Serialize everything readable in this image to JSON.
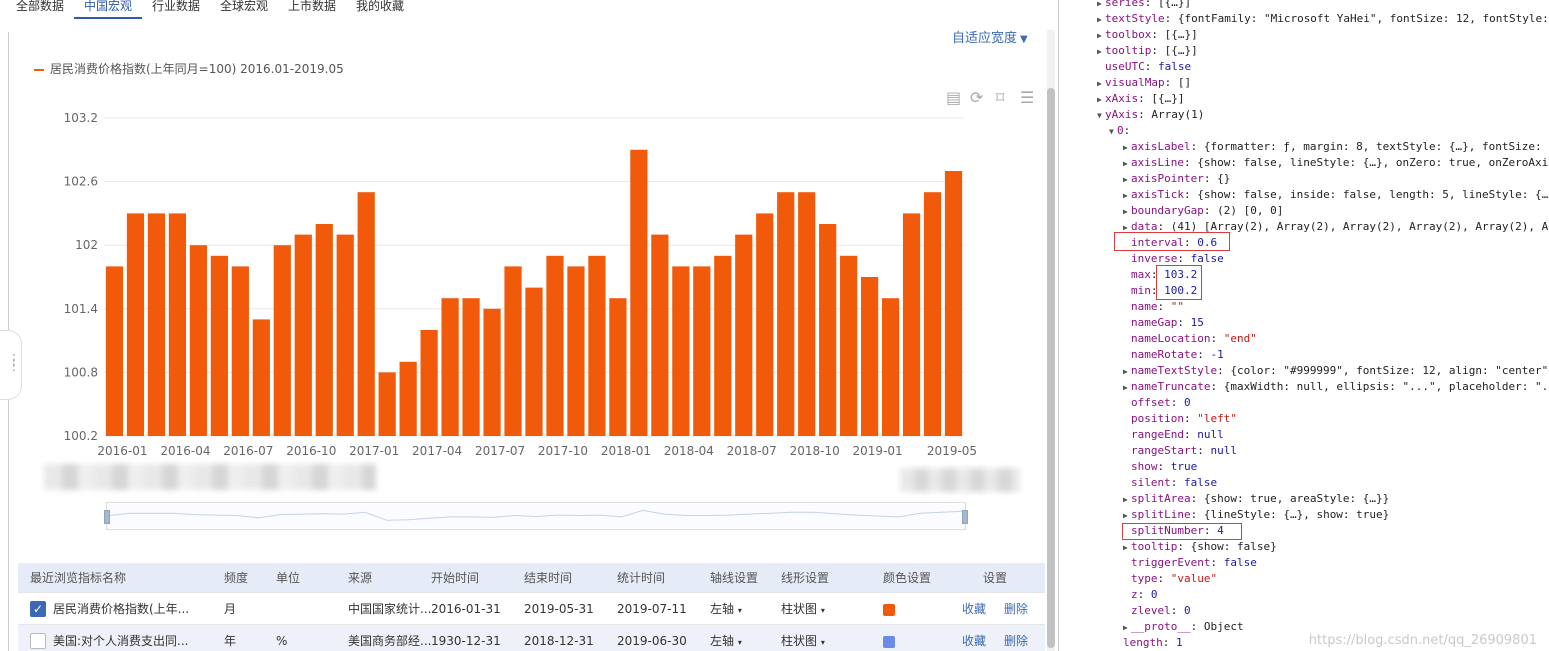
{
  "tabs": [
    "全部数据",
    "中国宏观",
    "行业数据",
    "全球宏观",
    "上市数据",
    "我的收藏"
  ],
  "active_tab": "中国宏观",
  "adapt_label": "自适应宽度",
  "legend_label": "居民消费价格指数(上年同月=100) 2016.01-2019.05",
  "colors": {
    "bar": "#f05a0a",
    "accent": "#3b6bb5",
    "swatch2": "#6b8be8"
  },
  "toolbox_icons": [
    "data-view-icon",
    "refresh-icon",
    "bookmark-icon",
    "menu-icon"
  ],
  "chart_data": {
    "type": "bar",
    "title": "",
    "series": [
      {
        "name": "居民消费价格指数(上年同月=100) 2016.01-2019.05",
        "values": [
          101.8,
          102.3,
          102.3,
          102.3,
          102.0,
          101.9,
          101.8,
          101.3,
          102.0,
          102.1,
          102.2,
          102.1,
          102.5,
          100.8,
          100.9,
          101.2,
          101.5,
          101.5,
          101.4,
          101.8,
          101.6,
          101.9,
          101.8,
          101.9,
          101.5,
          102.9,
          102.1,
          101.8,
          101.8,
          101.9,
          102.1,
          102.3,
          102.5,
          102.5,
          102.2,
          101.9,
          101.7,
          101.5,
          102.3,
          102.5,
          102.7
        ]
      }
    ],
    "categories": [
      "2016-01",
      "2016-02",
      "2016-03",
      "2016-04",
      "2016-05",
      "2016-06",
      "2016-07",
      "2016-08",
      "2016-09",
      "2016-10",
      "2016-11",
      "2016-12",
      "2017-01",
      "2017-02",
      "2017-03",
      "2017-04",
      "2017-05",
      "2017-06",
      "2017-07",
      "2017-08",
      "2017-09",
      "2017-10",
      "2017-11",
      "2017-12",
      "2018-01",
      "2018-02",
      "2018-03",
      "2018-04",
      "2018-05",
      "2018-06",
      "2018-07",
      "2018-08",
      "2018-09",
      "2018-10",
      "2018-11",
      "2018-12",
      "2019-01",
      "2019-02",
      "2019-03",
      "2019-04",
      "2019-05"
    ],
    "xtick_labels": [
      "2016-01",
      "2016-04",
      "2016-07",
      "2016-10",
      "2017-01",
      "2017-04",
      "2017-07",
      "2017-10",
      "2018-01",
      "2018-04",
      "2018-07",
      "2018-10",
      "2019-01",
      "2019-05"
    ],
    "ytick_labels": [
      "103.2",
      "102.6",
      "102",
      "101.4",
      "100.8",
      "100.2"
    ],
    "ylim": [
      100.2,
      103.2
    ],
    "ytick_values": [
      103.2,
      102.6,
      102.0,
      101.4,
      100.8,
      100.2
    ],
    "grid": true,
    "legend_position": "top-left"
  },
  "table": {
    "headers": [
      "最近浏览指标名称",
      "频度",
      "单位",
      "来源",
      "开始时间",
      "结束时间",
      "统计时间",
      "轴线设置",
      "线形设置",
      "颜色设置",
      "设置"
    ],
    "rows": [
      {
        "checked": true,
        "name": "居民消费价格指数(上年...",
        "freq": "月",
        "unit": "",
        "source": "中国国家统计...",
        "start": "2016-01-31",
        "end": "2019-05-31",
        "stat": "2019-07-11",
        "axis": "左轴",
        "shape": "柱状图",
        "color": "#f05a0a",
        "collect": "收藏",
        "delete": "删除"
      },
      {
        "checked": false,
        "name": "美国:对个人消费支出同...",
        "freq": "年",
        "unit": "%",
        "source": "美国商务部经...",
        "start": "1930-12-31",
        "end": "2018-12-31",
        "stat": "2019-06-30",
        "axis": "左轴",
        "shape": "柱状图",
        "color": "#6b8be8",
        "collect": "收藏",
        "delete": "删除"
      }
    ]
  },
  "devtools": [
    {
      "t": "▶",
      "k": "series",
      "v": "[{…}]"
    },
    {
      "t": "▶",
      "k": "textStyle",
      "v": "{fontFamily: \"Microsoft YaHei\", fontSize: 12, fontStyle:"
    },
    {
      "t": "▶",
      "k": "toolbox",
      "v": "[{…}]"
    },
    {
      "t": "▶",
      "k": "tooltip",
      "v": "[{…}]"
    },
    {
      "t": "",
      "k": "useUTC",
      "v": "false"
    },
    {
      "t": "▶",
      "k": "visualMap",
      "v": "[]"
    },
    {
      "t": "▶",
      "k": "xAxis",
      "v": "[{…}]"
    },
    {
      "t": "▼",
      "k": "yAxis",
      "v": "Array(1)"
    },
    {
      "t": "▼",
      "k": "0",
      "v": ""
    },
    {
      "t": "▶",
      "k": "axisLabel",
      "v": "{formatter: ƒ, margin: 8, textStyle: {…}, fontSize: 1"
    },
    {
      "t": "▶",
      "k": "axisLine",
      "v": "{show: false, lineStyle: {…}, onZero: true, onZeroAxis"
    },
    {
      "t": "▶",
      "k": "axisPointer",
      "v": "{}"
    },
    {
      "t": "▶",
      "k": "axisTick",
      "v": "{show: false, inside: false, length: 5, lineStyle: {…}"
    },
    {
      "t": "▶",
      "k": "boundaryGap",
      "v": "(2) [0, 0]"
    },
    {
      "t": "▶",
      "k": "data",
      "v": "(41) [Array(2), Array(2), Array(2), Array(2), Array(2), Ar"
    },
    {
      "t": "",
      "k": "interval",
      "v": "0.6"
    },
    {
      "t": "",
      "k": "inverse",
      "v": "false"
    },
    {
      "t": "",
      "k": "max",
      "v": "103.2"
    },
    {
      "t": "",
      "k": "min",
      "v": "100.2"
    },
    {
      "t": "",
      "k": "name",
      "v": "\"\""
    },
    {
      "t": "",
      "k": "nameGap",
      "v": "15"
    },
    {
      "t": "",
      "k": "nameLocation",
      "v": "\"end\""
    },
    {
      "t": "",
      "k": "nameRotate",
      "v": "-1"
    },
    {
      "t": "▶",
      "k": "nameTextStyle",
      "v": "{color: \"#999999\", fontSize: 12, align: \"center\"}"
    },
    {
      "t": "▶",
      "k": "nameTruncate",
      "v": "{maxWidth: null, ellipsis: \"...\", placeholder: \".\""
    },
    {
      "t": "",
      "k": "offset",
      "v": "0"
    },
    {
      "t": "",
      "k": "position",
      "v": "\"left\""
    },
    {
      "t": "",
      "k": "rangeEnd",
      "v": "null"
    },
    {
      "t": "",
      "k": "rangeStart",
      "v": "null"
    },
    {
      "t": "",
      "k": "show",
      "v": "true"
    },
    {
      "t": "",
      "k": "silent",
      "v": "false"
    },
    {
      "t": "▶",
      "k": "splitArea",
      "v": "{show: true, areaStyle: {…}}"
    },
    {
      "t": "▶",
      "k": "splitLine",
      "v": "{lineStyle: {…}, show: true}"
    },
    {
      "t": "",
      "k": "splitNumber",
      "v": "4"
    },
    {
      "t": "▶",
      "k": "tooltip",
      "v": "{show: false}"
    },
    {
      "t": "",
      "k": "triggerEvent",
      "v": "false"
    },
    {
      "t": "",
      "k": "type",
      "v": "\"value\""
    },
    {
      "t": "",
      "k": "z",
      "v": "0"
    },
    {
      "t": "",
      "k": "zlevel",
      "v": "0"
    },
    {
      "t": "▶",
      "k": "__proto__",
      "v": "Object"
    },
    {
      "t": "",
      "k": "length",
      "v": "1"
    }
  ],
  "watermark": "https://blog.csdn.net/qq_26909801"
}
